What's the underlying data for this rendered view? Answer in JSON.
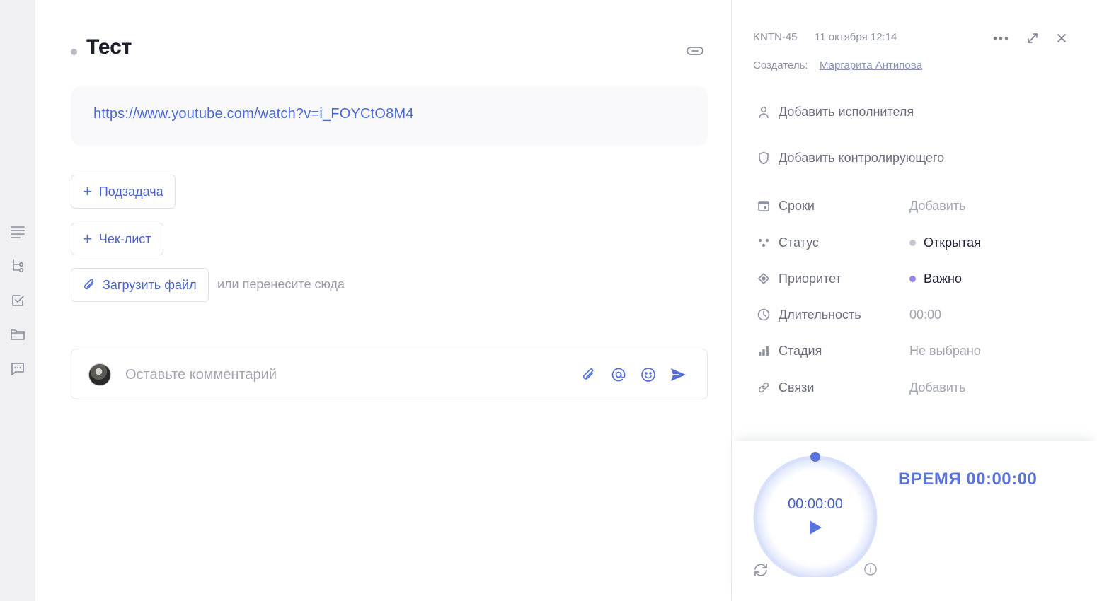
{
  "task": {
    "title": "Тест",
    "description_link": "https://www.youtube.com/watch?v=i_FOYCtO8M4"
  },
  "actions": {
    "subtask_label": "Подзадача",
    "checklist_label": "Чек-лист",
    "upload_label": "Загрузить файл",
    "upload_hint": "или перенесите сюда"
  },
  "comment": {
    "placeholder": "Оставьте комментарий"
  },
  "sidebar": {
    "icons": [
      "list-icon",
      "subtasks-icon",
      "checklist-icon",
      "folder-icon",
      "chat-icon"
    ]
  },
  "details": {
    "id": "KNTN-45",
    "date": "11 октября 12:14",
    "creator_label": "Создатель:",
    "creator_name": "Маргарита Антипова",
    "add_assignee": "Добавить исполнителя",
    "add_controller": "Добавить контролирующего",
    "props": {
      "deadline": {
        "label": "Сроки",
        "value": "Добавить"
      },
      "status": {
        "label": "Статус",
        "value": "Открытая",
        "color": "#c5c7cf"
      },
      "priority": {
        "label": "Приоритет",
        "value": "Важно",
        "color": "#9b84ee"
      },
      "duration": {
        "label": "Длительность",
        "value": "00:00"
      },
      "stage": {
        "label": "Стадия",
        "value": "Не выбрано"
      },
      "links": {
        "label": "Связи",
        "value": "Добавить"
      }
    }
  },
  "timer": {
    "display": "00:00:00",
    "time_label": "ВРЕМЯ 00:00:00",
    "accent": "#5b73dc"
  }
}
